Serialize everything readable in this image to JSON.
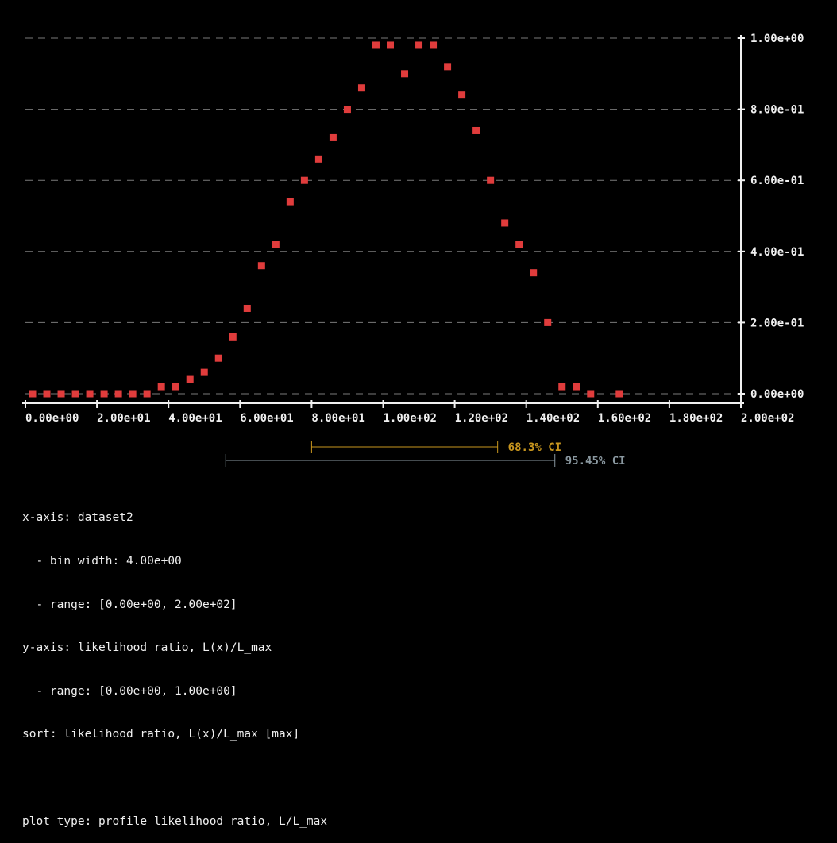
{
  "chart_data": {
    "type": "scatter",
    "x": [
      0,
      4,
      8,
      12,
      16,
      20,
      24,
      28,
      32,
      36,
      40,
      44,
      48,
      52,
      56,
      60,
      64,
      68,
      72,
      76,
      80,
      84,
      88,
      92,
      96,
      100,
      104,
      108,
      112,
      116,
      120,
      124,
      128,
      132,
      136,
      140,
      144,
      148,
      152,
      156,
      164
    ],
    "y": [
      0,
      0,
      0,
      0,
      0,
      0,
      0,
      0,
      0,
      0.02,
      0.02,
      0.04,
      0.06,
      0.1,
      0.16,
      0.24,
      0.36,
      0.42,
      0.54,
      0.6,
      0.66,
      0.72,
      0.8,
      0.86,
      0.98,
      0.98,
      0.9,
      0.98,
      0.98,
      0.92,
      0.84,
      0.74,
      0.6,
      0.48,
      0.42,
      0.34,
      0.2,
      0.02,
      0.02,
      0,
      0
    ],
    "xlim": [
      0,
      200
    ],
    "ylim": [
      0,
      1
    ],
    "x_ticks": [
      0,
      20,
      40,
      60,
      80,
      100,
      120,
      140,
      160,
      180,
      200
    ],
    "x_tick_labels": [
      "0.00e+00",
      "2.00e+01",
      "4.00e+01",
      "6.00e+01",
      "8.00e+01",
      "1.00e+02",
      "1.20e+02",
      "1.40e+02",
      "1.60e+02",
      "1.80e+02",
      "2.00e+02"
    ],
    "y_ticks": [
      0,
      0.2,
      0.4,
      0.6,
      0.8,
      1.0
    ],
    "y_tick_labels": [
      "0.00e+00",
      "2.00e-01",
      "4.00e-01",
      "6.00e-01",
      "8.00e-01",
      "1.00e+00"
    ],
    "grid": true,
    "y_axis_position": "right",
    "marker_color": "#e03c3c",
    "intervals": [
      {
        "label": "68.3% CI",
        "low": 80,
        "high": 132,
        "color": "#c8961e"
      },
      {
        "label": "95.45% CI",
        "low": 56,
        "high": 148,
        "color": "#8a98a0"
      }
    ]
  },
  "info_lines": [
    "x-axis: dataset2",
    "  - bin width: 4.00e+00",
    "  - range: [0.00e+00, 2.00e+02]",
    "y-axis: likelihood ratio, L(x)/L_max",
    "  - range: [0.00e+00, 1.00e+00]",
    "sort: likelihood ratio, L(x)/L_max [max]",
    "",
    "plot type: profile likelihood ratio, L/L_max"
  ]
}
